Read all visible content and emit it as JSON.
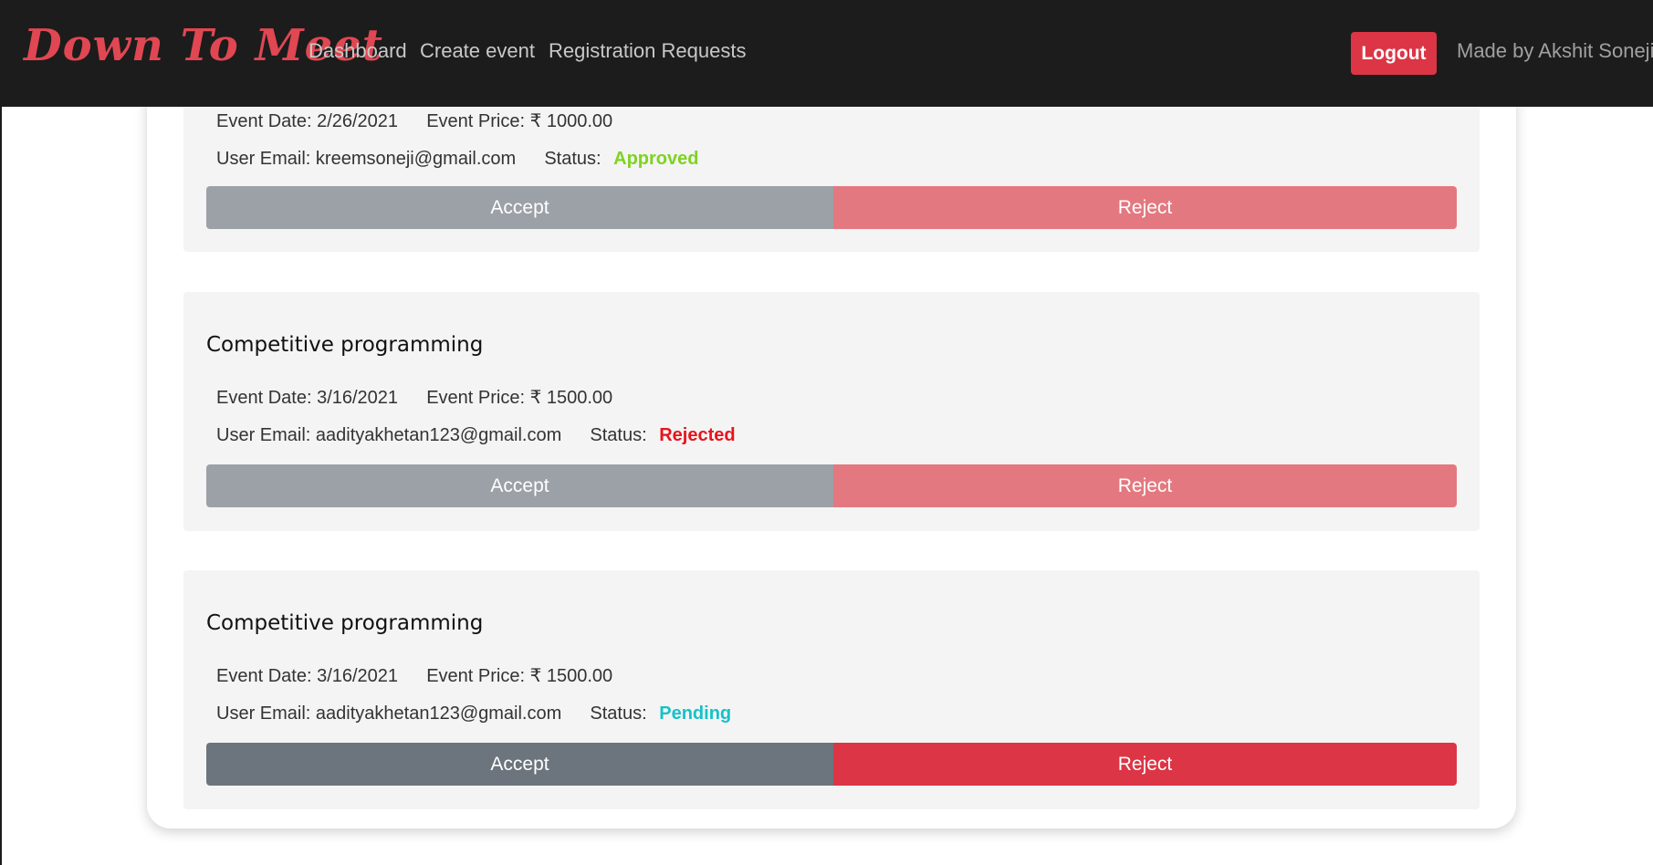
{
  "nav": {
    "brand": "Down To Meet",
    "links": [
      "Dashboard",
      "Create event",
      "Registration Requests"
    ],
    "logout_label": "Logout",
    "credit": "Made by Akshit Soneji"
  },
  "labels": {
    "event_date": "Event Date:",
    "event_price": "Event Price:",
    "user_email": "User Email:",
    "status": "Status:",
    "accept": "Accept",
    "reject": "Reject"
  },
  "requests": [
    {
      "title": "",
      "event_date": "2/26/2021",
      "event_price": "₹ 1000.00",
      "user_email": "kreemsoneji@gmail.com",
      "status": "Approved",
      "status_color": "#7ed321",
      "buttons_enabled": false
    },
    {
      "title": "Competitive programming",
      "event_date": "3/16/2021",
      "event_price": "₹ 1500.00",
      "user_email": "aadityakhetan123@gmail.com",
      "status": "Rejected",
      "status_color": "#e8141c",
      "buttons_enabled": false
    },
    {
      "title": "Competitive programming",
      "event_date": "3/16/2021",
      "event_price": "₹ 1500.00",
      "user_email": "aadityakhetan123@gmail.com",
      "status": "Pending",
      "status_color": "#17c1c8",
      "buttons_enabled": true
    }
  ],
  "colors": {
    "accept_enabled": "#6c757d",
    "accept_disabled": "#9ca1a7",
    "reject_enabled": "#dc3545",
    "reject_disabled": "#e47880"
  }
}
